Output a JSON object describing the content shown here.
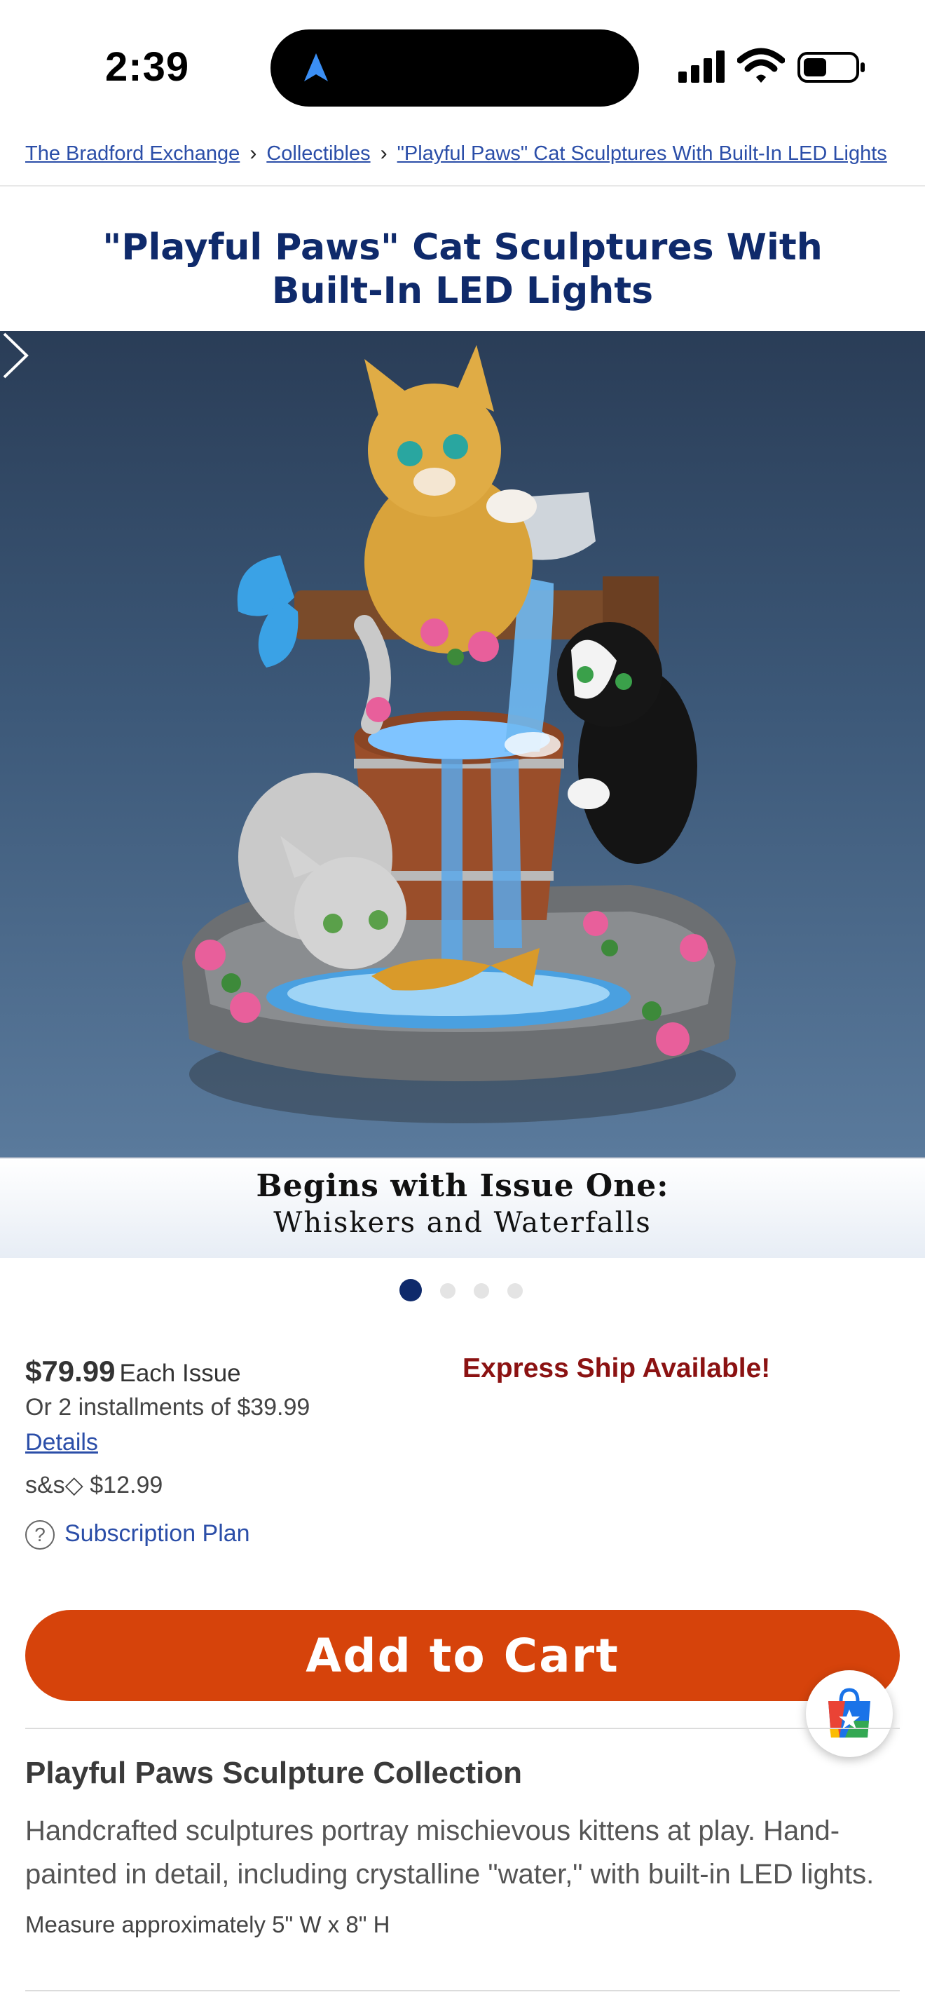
{
  "status_bar": {
    "time": "2:39"
  },
  "breadcrumb": {
    "items": [
      "The Bradford Exchange",
      "Collectibles",
      "\"Playful Paws\" Cat Sculptures With Built-In LED Lights"
    ]
  },
  "product": {
    "title": "\"Playful Paws\" Cat Sculptures With Built-In LED Lights",
    "image_banner": {
      "line1": "Begins with Issue One:",
      "line2": "Whiskers and Waterfalls"
    },
    "carousel": {
      "count": 4,
      "active": 1
    },
    "price": "$79.99",
    "price_unit": "Each Issue",
    "installments": "Or 2 installments of $39.99",
    "details_link": "Details",
    "shipping": "s&s◇ $12.99",
    "subscription_link": "Subscription Plan",
    "express": "Express Ship Available!",
    "add_to_cart": "Add to Cart"
  },
  "collection": {
    "heading": "Playful Paws Sculpture Collection",
    "description": "Handcrafted sculptures portray mischievous kittens at play. Hand-painted in detail, including crystalline \"water,\" with built-in LED lights.",
    "measure": "Measure approximately 5\" W x 8\" H"
  },
  "colors": {
    "accent": "#d6430b",
    "title": "#0f2a6b",
    "link": "#2b4ea8",
    "express": "#8b1212"
  }
}
